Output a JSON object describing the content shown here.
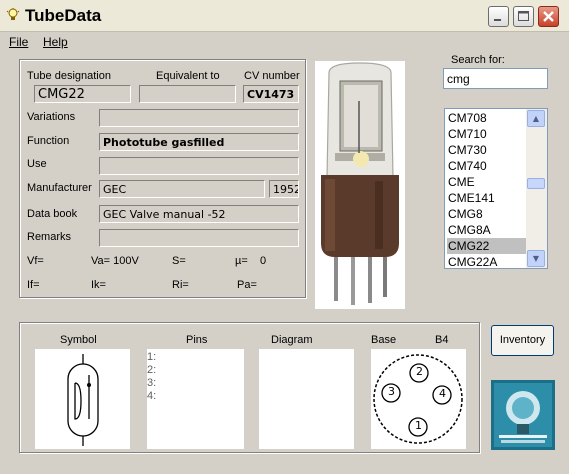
{
  "window": {
    "title": "TubeData"
  },
  "menu": {
    "file": "File",
    "help": "Help"
  },
  "labels": {
    "tube_designation": "Tube designation",
    "equivalent_to": "Equivalent to",
    "cv_number": "CV number",
    "variations": "Variations",
    "function": "Function",
    "use": "Use",
    "manufacturer": "Manufacturer",
    "data_book": "Data book",
    "remarks": "Remarks",
    "search_for": "Search for:"
  },
  "fields": {
    "tube_designation": "CMG22",
    "equivalent_to": "",
    "cv_number": "CV1473",
    "variations": "",
    "function": "Phototube gasfilled",
    "use": "",
    "manufacturer": "GEC",
    "year": "1952",
    "data_book": "GEC Valve manual -52",
    "remarks": ""
  },
  "electrical": {
    "vf": "Vf=",
    "va": "Va= 100V",
    "s": "S=",
    "mu_label": "µ=",
    "mu_value": "0",
    "if": "If=",
    "ik": "Ik=",
    "ri": "Ri=",
    "pa": "Pa="
  },
  "search": {
    "value": "cmg"
  },
  "tube_list": {
    "items": [
      "CM708",
      "CM710",
      "CM730",
      "CM740",
      "CME",
      "CME141",
      "CMG8",
      "CMG8A",
      "CMG22",
      "CMG22A"
    ],
    "selected": "CMG22"
  },
  "bottom": {
    "symbol": "Symbol",
    "pins": "Pins",
    "diagram": "Diagram",
    "base": "Base",
    "base_type": "B4",
    "pin_rows": [
      "1:",
      "2:",
      "3:",
      "4:"
    ],
    "base_pins": [
      "1",
      "2",
      "3",
      "4"
    ]
  },
  "buttons": {
    "inventory": "Inventory"
  },
  "colors": {
    "title_bar": "#ece9d8",
    "close_button": "#c8412b",
    "selection": "#c0c0c0",
    "window": "#d4d0c8"
  },
  "icons": {
    "app": "lightbulb-icon",
    "minimize": "minimize-icon",
    "maximize": "maximize-icon",
    "close": "close-icon"
  }
}
